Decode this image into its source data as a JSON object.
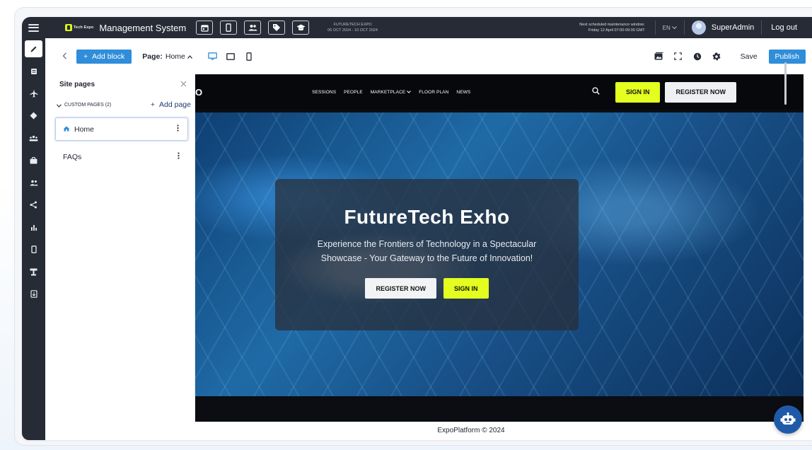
{
  "topbar": {
    "logo_text": "Tech Expo",
    "title": "Management System",
    "event_name": "FUTURETECH EXPO",
    "event_dates": "06 OCT 2024 - 10 OCT 2024",
    "maintenance_line1": "Next scheduled maintenance window:",
    "maintenance_line2": "Friday 12 April 07:00-09:00 GMT",
    "language": "EN",
    "user_name": "SuperAdmin",
    "logout": "Log out"
  },
  "toolbar": {
    "add_block": "Add block",
    "page_label": "Page:",
    "page_value": "Home",
    "save": "Save",
    "publish": "Publish"
  },
  "pages_panel": {
    "title": "Site pages",
    "section": "CUSTOM PAGES (2)",
    "add_page": "Add page",
    "items": [
      {
        "label": "Home"
      },
      {
        "label": "FAQs"
      }
    ]
  },
  "site": {
    "logo": "O",
    "nav": [
      "SESSIONS",
      "PEOPLE",
      "MARKETPLACE",
      "FLOOR PLAN",
      "NEWS"
    ],
    "sign_in": "SIGN IN",
    "register": "REGISTER NOW",
    "hero_title": "FutureTech Exho",
    "hero_subtitle": "Experience the Frontiers of Technology in a Spectacular Showcase - Your Gateway to the Future of Innovation!",
    "hero_register": "REGISTER NOW",
    "hero_sign_in": "SIGN IN"
  },
  "footer": {
    "text": "ExpoPlatform © 2024"
  },
  "colors": {
    "topbar_bg": "#262b35",
    "accent_blue": "#2f8dd9",
    "accent_lime": "#e4ff1f"
  }
}
